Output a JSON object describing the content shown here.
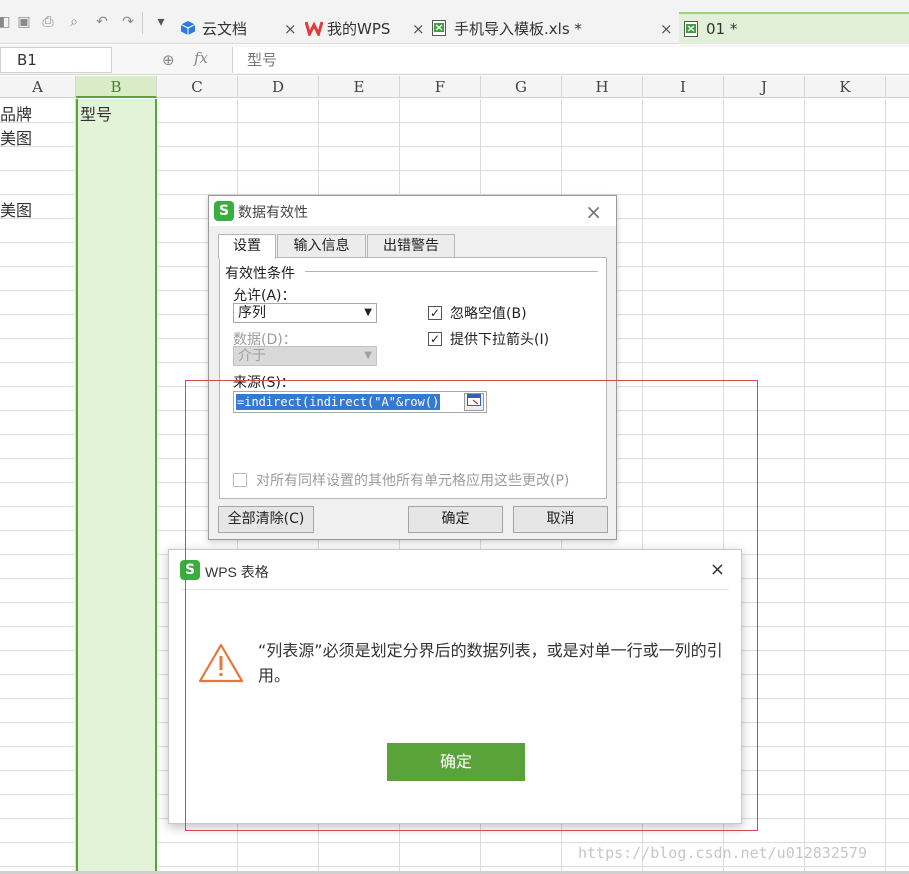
{
  "topbar": {
    "tabs": [
      {
        "label": "云文档",
        "close": "×"
      },
      {
        "label": "我的WPS",
        "close": "×"
      },
      {
        "label": "手机导入模板.xls *",
        "close": "×"
      },
      {
        "label": "01 *"
      }
    ],
    "dropdown_glyph": "▾"
  },
  "formula": {
    "cell_ref": "B1",
    "zoom_glyph": "⊕",
    "fx": "fx",
    "content": "型号"
  },
  "grid": {
    "columns": [
      "A",
      "B",
      "C",
      "D",
      "E",
      "F",
      "G",
      "H",
      "I",
      "J",
      "K"
    ],
    "selected_column": "B",
    "cells": {
      "a1": "品牌",
      "b1": "型号",
      "a2": "美图",
      "a5": "美图"
    }
  },
  "validation_dialog": {
    "title": "数据有效性",
    "close": "×",
    "tabs": [
      "设置",
      "输入信息",
      "出错警告"
    ],
    "section": "有效性条件",
    "allow_label": "允许(A)：",
    "allow_value": "序列",
    "data_label": "数据(D)：",
    "data_value": "介于",
    "ignore_blank": {
      "label": "忽略空值(B)",
      "checked": true
    },
    "dropdown_arrow": {
      "label": "提供下拉箭头(I)",
      "checked": true
    },
    "source_label": "来源(S)：",
    "source_value": "=indirect(indirect(\"A\"&row()",
    "apply_all_label": "对所有同样设置的其他所有单元格应用这些更改(P)",
    "clear_all": "全部清除(C)",
    "ok": "确定",
    "cancel": "取消",
    "check_glyph": "✓"
  },
  "alert": {
    "title": "WPS 表格",
    "close": "×",
    "message": "“列表源”必须是划定分界后的数据列表，或是对单一行或一列的引用。",
    "ok": "确定",
    "icon": "warning-icon"
  },
  "watermark": "https://blog.csdn.net/u012832579",
  "colors": {
    "accent_green": "#5aa33a",
    "selection_fill": "#e3f3d8",
    "selection_text": "#3579d2",
    "annotation_red": "#e0434a",
    "warning_orange": "#e8763a"
  }
}
